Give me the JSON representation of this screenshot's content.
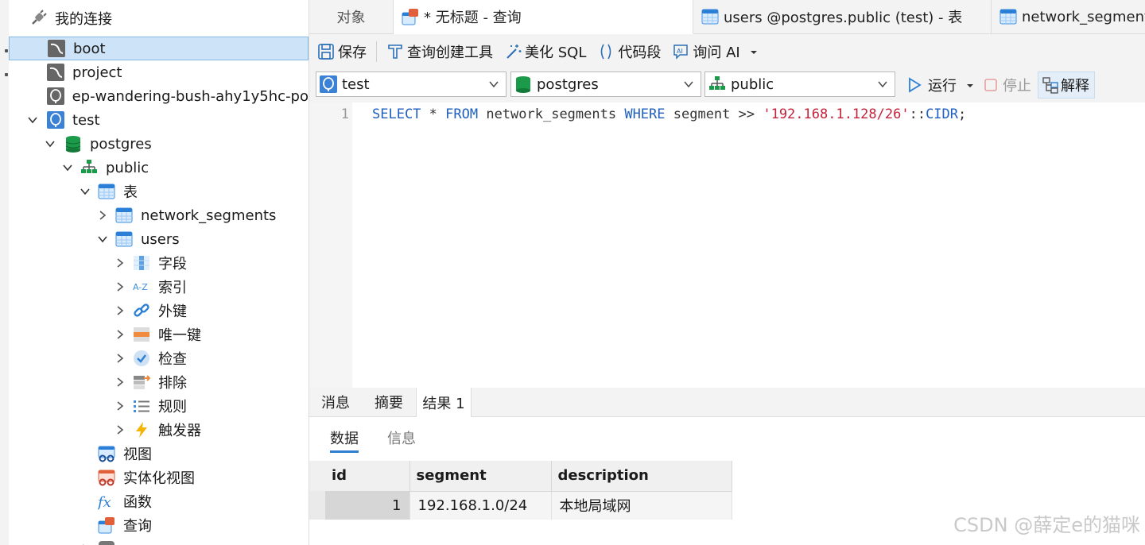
{
  "sidebar": {
    "header": "我的连接",
    "items": [
      {
        "label": "boot",
        "icon": "mysql-icon"
      },
      {
        "label": "project",
        "icon": "mysql-icon"
      },
      {
        "label": "ep-wandering-bush-ahy1y5hc-po",
        "icon": "postgres-icon"
      },
      {
        "label": "test",
        "icon": "postgres-icon"
      },
      {
        "label": "postgres",
        "icon": "database-icon"
      },
      {
        "label": "public",
        "icon": "schema-icon"
      },
      {
        "label": "表",
        "icon": "table-icon"
      },
      {
        "label": "network_segments",
        "icon": "table-icon"
      },
      {
        "label": "users",
        "icon": "table-icon"
      },
      {
        "label": "字段",
        "icon": "fields-icon"
      },
      {
        "label": "索引",
        "icon": "index-icon"
      },
      {
        "label": "外键",
        "icon": "foreign-key-icon"
      },
      {
        "label": "唯一键",
        "icon": "unique-key-icon"
      },
      {
        "label": "检查",
        "icon": "check-icon"
      },
      {
        "label": "排除",
        "icon": "exclude-icon"
      },
      {
        "label": "规则",
        "icon": "rules-icon"
      },
      {
        "label": "触发器",
        "icon": "trigger-icon"
      },
      {
        "label": "视图",
        "icon": "view-icon"
      },
      {
        "label": "实体化视图",
        "icon": "materialized-view-icon"
      },
      {
        "label": "函数",
        "icon": "function-icon"
      },
      {
        "label": "查询",
        "icon": "query-icon"
      }
    ]
  },
  "tabs": [
    {
      "label": "对象"
    },
    {
      "label": "* 无标题 - 查询"
    },
    {
      "label": "users @postgres.public (test) - 表"
    },
    {
      "label": "network_segments"
    }
  ],
  "toolbar": {
    "save": "保存",
    "query_builder": "查询创建工具",
    "beautify": "美化 SQL",
    "snippet": "代码段",
    "ask_ai": "询问 AI"
  },
  "selects": {
    "connection": "test",
    "database": "postgres",
    "schema": "public",
    "run": "运行",
    "stop": "停止",
    "explain": "解释"
  },
  "editor": {
    "line_number": "1",
    "tokens": {
      "select": "SELECT",
      "star": " * ",
      "from": "FROM",
      "table": " network_segments ",
      "where": "WHERE",
      "cond": " segment >> ",
      "literal": "'192.168.1.128/26'",
      "cast": "::",
      "type": "CIDR",
      "end": ";"
    }
  },
  "results": {
    "tabs": [
      "消息",
      "摘要",
      "结果 1"
    ],
    "subtabs": [
      "数据",
      "信息"
    ],
    "columns": [
      "id",
      "segment",
      "description"
    ],
    "rows": [
      {
        "id": "1",
        "segment": "192.168.1.0/24",
        "description": "本地局域网"
      }
    ]
  },
  "watermark": "CSDN @薛定e的猫咪",
  "colors": {
    "accent": "#2f7fd1",
    "keyword": "#1f5fbf",
    "string": "#c4213a",
    "selection": "#cde3f7"
  }
}
